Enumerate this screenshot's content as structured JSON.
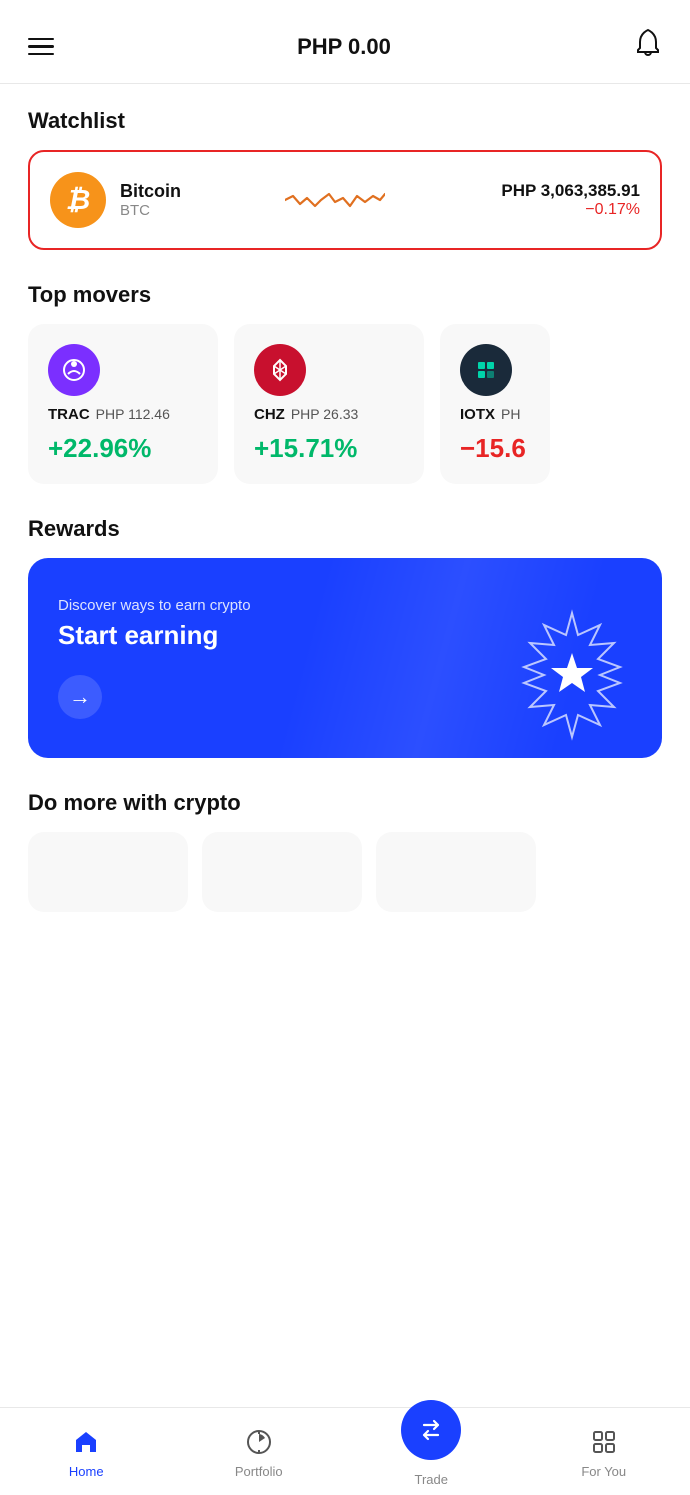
{
  "header": {
    "balance": "PHP 0.00",
    "hamburger_label": "menu",
    "bell_label": "notifications"
  },
  "watchlist": {
    "section_title": "Watchlist",
    "item": {
      "name": "Bitcoin",
      "ticker": "BTC",
      "price": "PHP 3,063,385.91",
      "change": "−0.17%",
      "change_type": "negative"
    }
  },
  "top_movers": {
    "section_title": "Top movers",
    "items": [
      {
        "ticker": "TRAC",
        "price": "PHP 112.46",
        "change": "+22.96%",
        "change_type": "positive",
        "icon_type": "trac"
      },
      {
        "ticker": "CHZ",
        "price": "PHP 26.33",
        "change": "+15.71%",
        "change_type": "positive",
        "icon_type": "chz"
      },
      {
        "ticker": "IOTX",
        "price": "PH...",
        "change": "−15.6",
        "change_type": "negative",
        "icon_type": "iotx"
      }
    ]
  },
  "rewards": {
    "section_title": "Rewards",
    "subtitle": "Discover ways to earn crypto",
    "title": "Start earning",
    "arrow_label": "go"
  },
  "do_more": {
    "section_title": "Do more with crypto"
  },
  "bottom_nav": {
    "items": [
      {
        "label": "Home",
        "icon": "home",
        "active": true
      },
      {
        "label": "Portfolio",
        "icon": "portfolio",
        "active": false
      },
      {
        "label": "Trade",
        "icon": "trade",
        "active": false
      },
      {
        "label": "For You",
        "icon": "foryou",
        "active": false
      }
    ]
  }
}
